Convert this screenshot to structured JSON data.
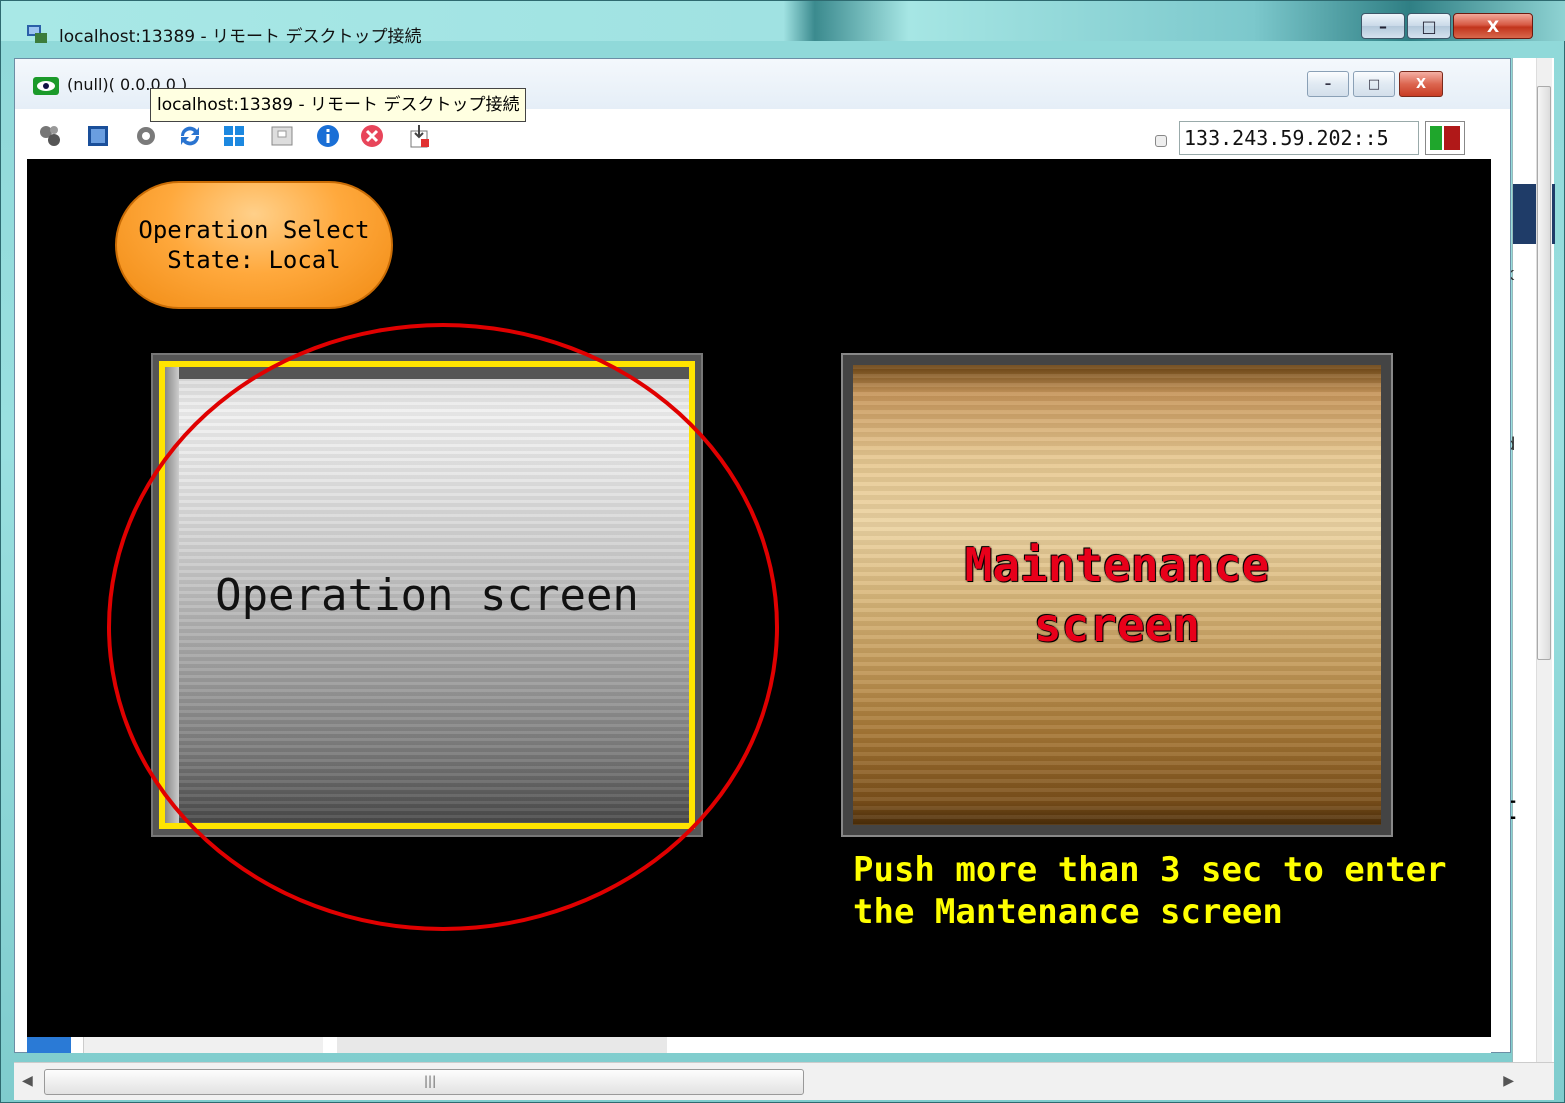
{
  "outer_window": {
    "title": "localhost:13389 - リモート デスクトップ接続",
    "min_glyph": "–",
    "max_glyph": "□",
    "close_glyph": "X"
  },
  "inner_window": {
    "title": "(null)( 0.0.0.0 )",
    "min_glyph": "–",
    "max_glyph": "□",
    "close_glyph": "X"
  },
  "tooltip": "localhost:13389 - リモート デスクトップ接続",
  "toolbar": {
    "icons": [
      "connect-icon",
      "fullscreen-icon",
      "settings-icon",
      "refresh-icon",
      "windows-start-icon",
      "send-keys-icon",
      "info-icon",
      "disconnect-icon",
      "transfer-file-icon"
    ],
    "address": "133.243.59.202::5"
  },
  "remote_screen": {
    "op_select_line1": "Operation Select",
    "op_select_line2": "State: Local",
    "operation_button": "Operation screen",
    "maintenance_line1": "Maintenance",
    "maintenance_line2": "screen",
    "hint_line1": "Push more than 3 sec to enter",
    "hint_line2": "the Mantenance screen"
  },
  "background_app": {
    "fragments": [
      "ak",
      "IC",
      "ed",
      "st"
    ]
  },
  "colors": {
    "orange_button": "#f08a12",
    "yellow_border": "#ffe400",
    "maintenance_text": "#e8001a",
    "hint_text": "#ffff00",
    "annotation_circle": "#e00000"
  }
}
